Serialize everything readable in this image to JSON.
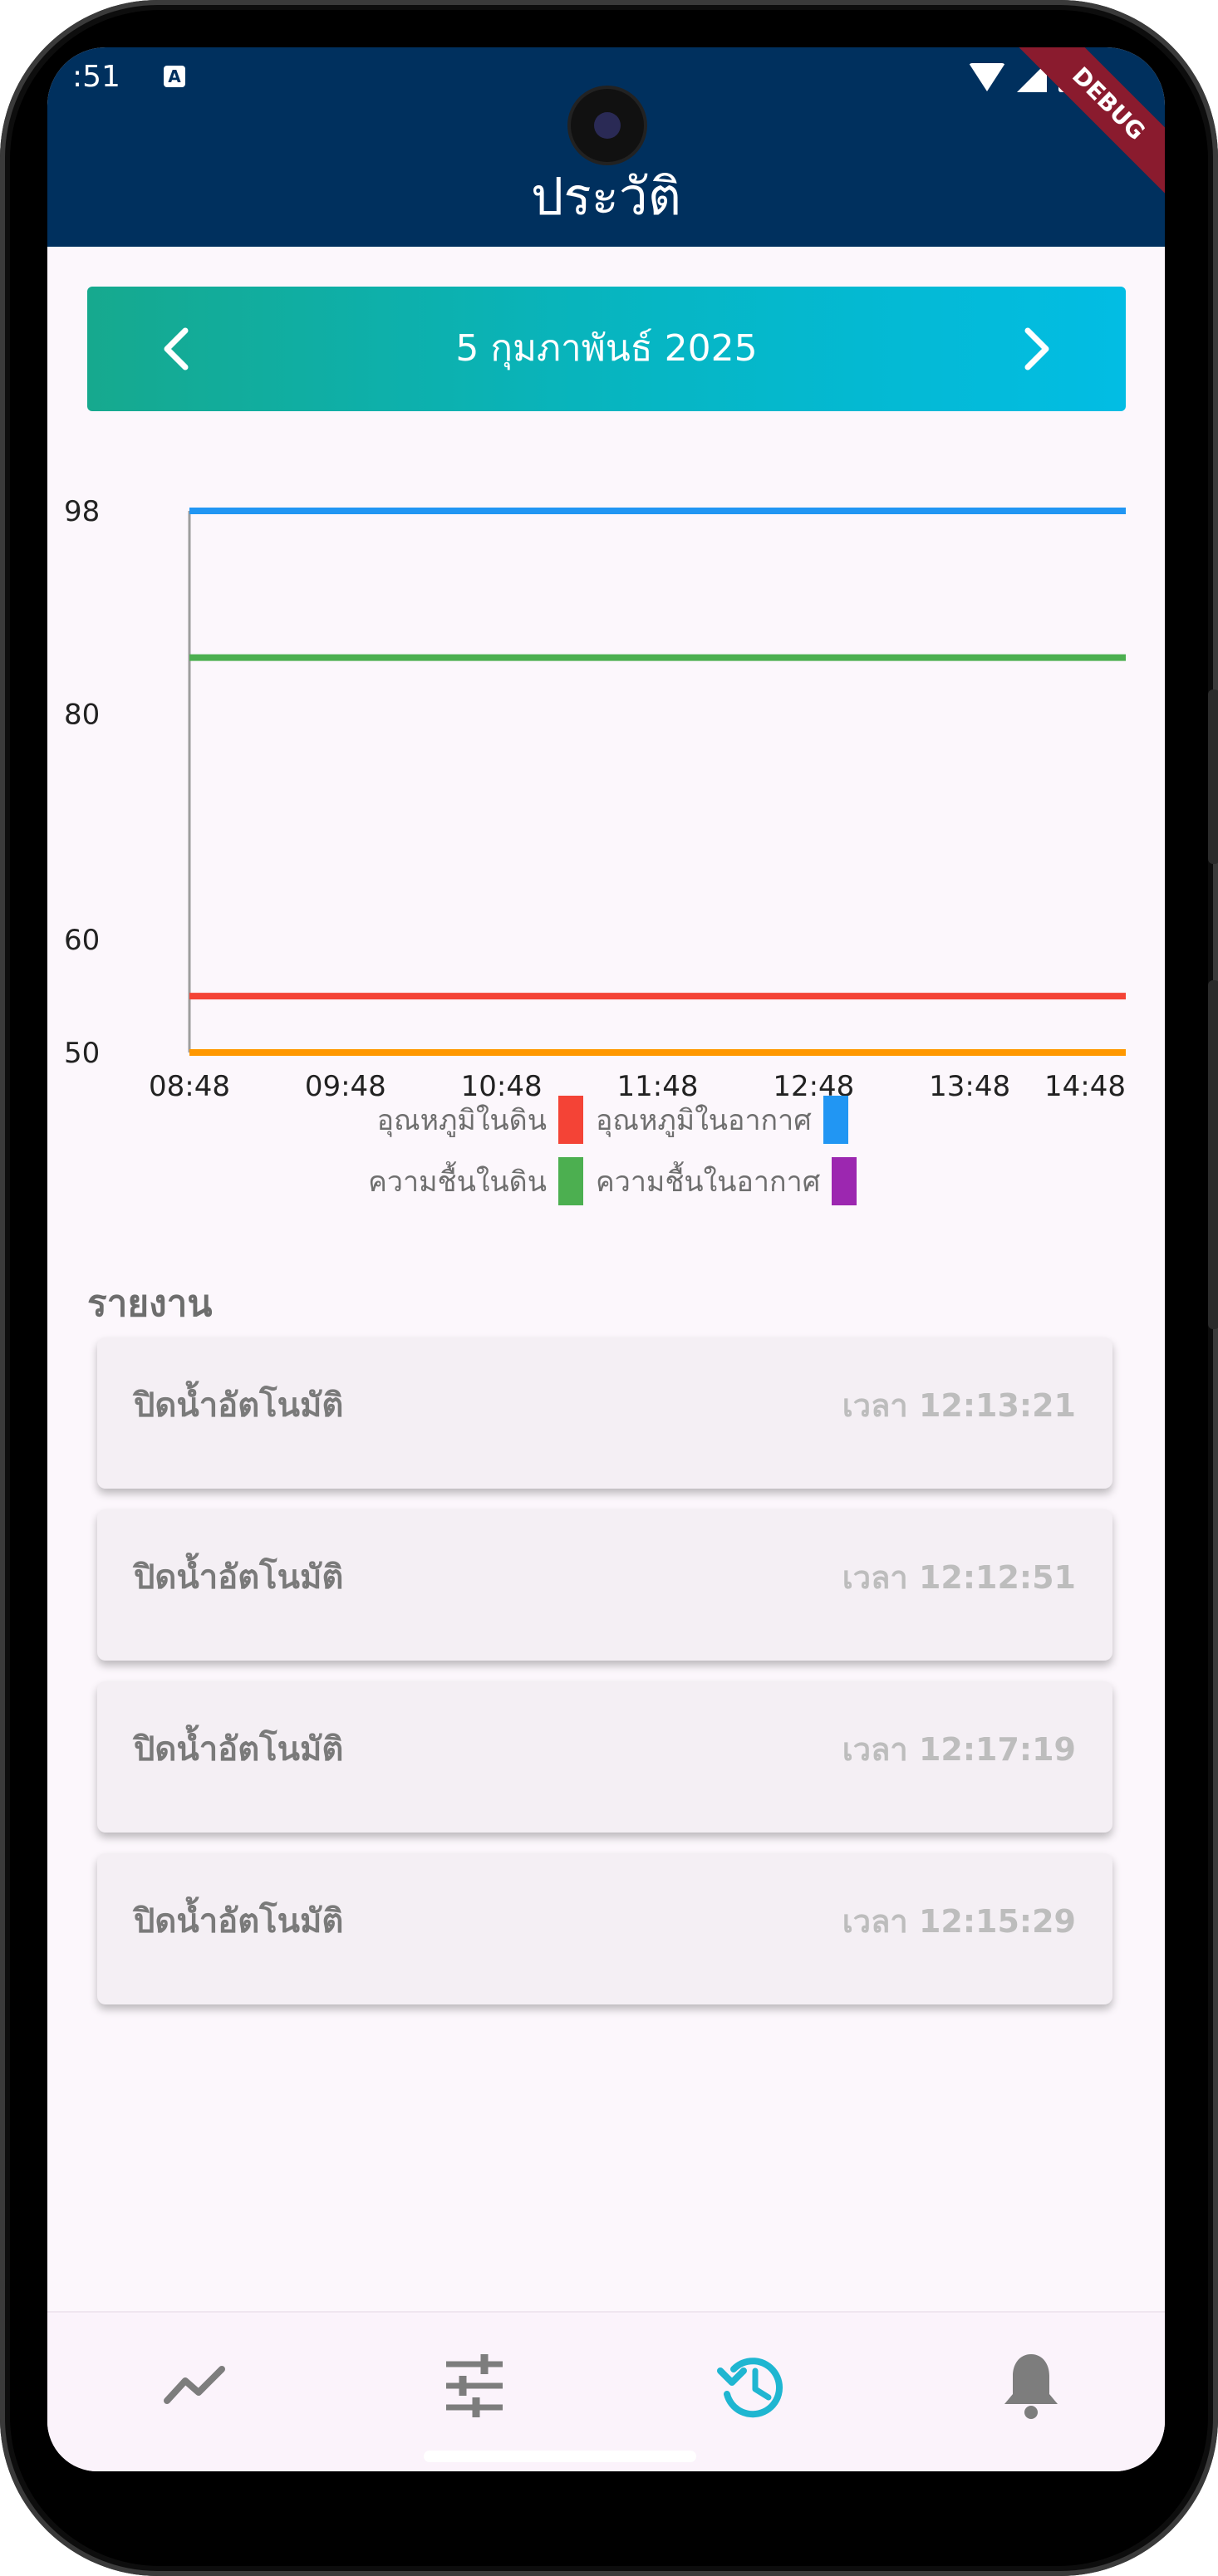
{
  "status_bar": {
    "time": ":51",
    "debug_banner": "DEBUG"
  },
  "app_bar": {
    "title": "ประวัติ"
  },
  "date_nav": {
    "date": "5 กุมภาพันธ์ 2025",
    "prev_icon": "chevron-left-icon",
    "next_icon": "chevron-right-icon"
  },
  "chart_data": {
    "type": "line",
    "x_tick_labels": [
      "08:48",
      "09:48",
      "10:48",
      "11:48",
      "12:48",
      "13:48",
      "14:48"
    ],
    "y_tick_labels": [
      "50",
      "60",
      "80",
      "98"
    ],
    "ylim": [
      50,
      98
    ],
    "grid": false,
    "legend_position": "bottom",
    "series": [
      {
        "name": "อุณหภูมิในดิน",
        "color": "#f44336",
        "values": [
          55,
          55,
          55,
          55,
          55,
          55,
          55
        ]
      },
      {
        "name": "อุณหภูมิในอากาศ",
        "color": "#2196f3",
        "values": [
          98,
          98,
          98,
          98,
          98,
          98,
          98
        ]
      },
      {
        "name": "ความชื้นในดิน",
        "color": "#4caf50",
        "values": [
          85,
          85,
          85,
          85,
          85,
          85,
          85
        ]
      },
      {
        "name": "ความชื้นในอากาศ",
        "color": "#9c27b0",
        "values": []
      },
      {
        "color": "#ff9800",
        "values": [
          50,
          50,
          50,
          50,
          50,
          50,
          50
        ]
      }
    ]
  },
  "report": {
    "heading": "รายงาน",
    "items": [
      {
        "label": "ปิดน้ำอัตโนมัติ",
        "time": "เวลา 12:13:21"
      },
      {
        "label": "ปิดน้ำอัตโนมัติ",
        "time": "เวลา 12:12:51"
      },
      {
        "label": "ปิดน้ำอัตโนมัติ",
        "time": "เวลา 12:17:19"
      },
      {
        "label": "ปิดน้ำอัตโนมัติ",
        "time": "เวลา 12:15:29"
      }
    ]
  },
  "bottom_nav": {
    "items": [
      {
        "icon": "trending-line-icon",
        "active": false
      },
      {
        "icon": "sliders-icon",
        "active": false
      },
      {
        "icon": "history-icon",
        "active": true
      },
      {
        "icon": "bell-icon",
        "active": false
      }
    ],
    "active_color": "#1fb6d1",
    "inactive_color": "#7d7d7d"
  }
}
